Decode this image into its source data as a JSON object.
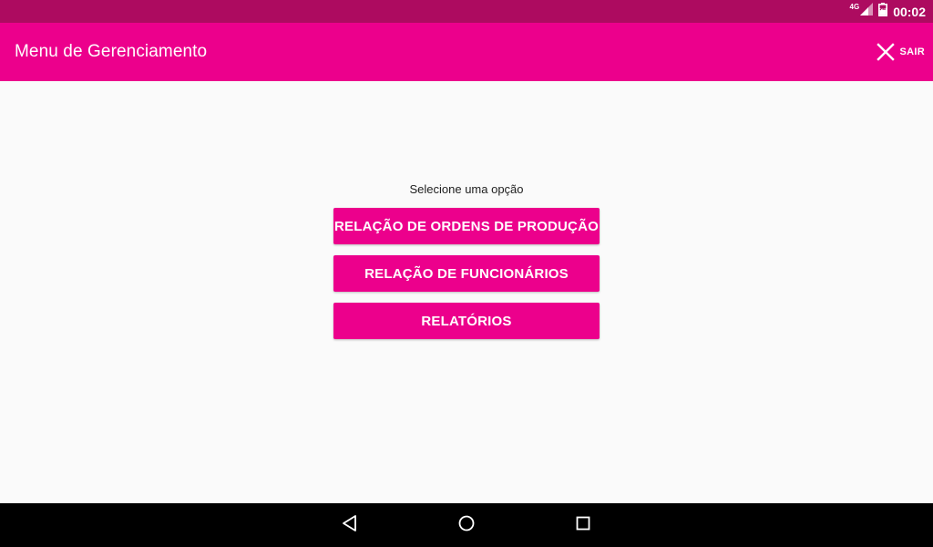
{
  "status_bar": {
    "network": "4G",
    "time": "00:02",
    "icons": [
      "signal-icon",
      "battery-icon"
    ]
  },
  "app_bar": {
    "title": "Menu de Gerenciamento",
    "action_label": "SAIR",
    "action_icon": "close-icon"
  },
  "main": {
    "prompt": "Selecione uma opção",
    "buttons": [
      {
        "label": "RELAÇÃO DE ORDENS DE PRODUÇÃO"
      },
      {
        "label": "RELAÇÃO DE FUNCIONÁRIOS"
      },
      {
        "label": "RELATÓRIOS"
      }
    ]
  },
  "nav_bar": {
    "icons": [
      "back-icon",
      "home-icon",
      "recents-icon"
    ]
  },
  "colors": {
    "primary": "#ec008c",
    "primary_dark": "#ad0b60",
    "background": "#fafafa",
    "nav_bar": "#000000"
  }
}
